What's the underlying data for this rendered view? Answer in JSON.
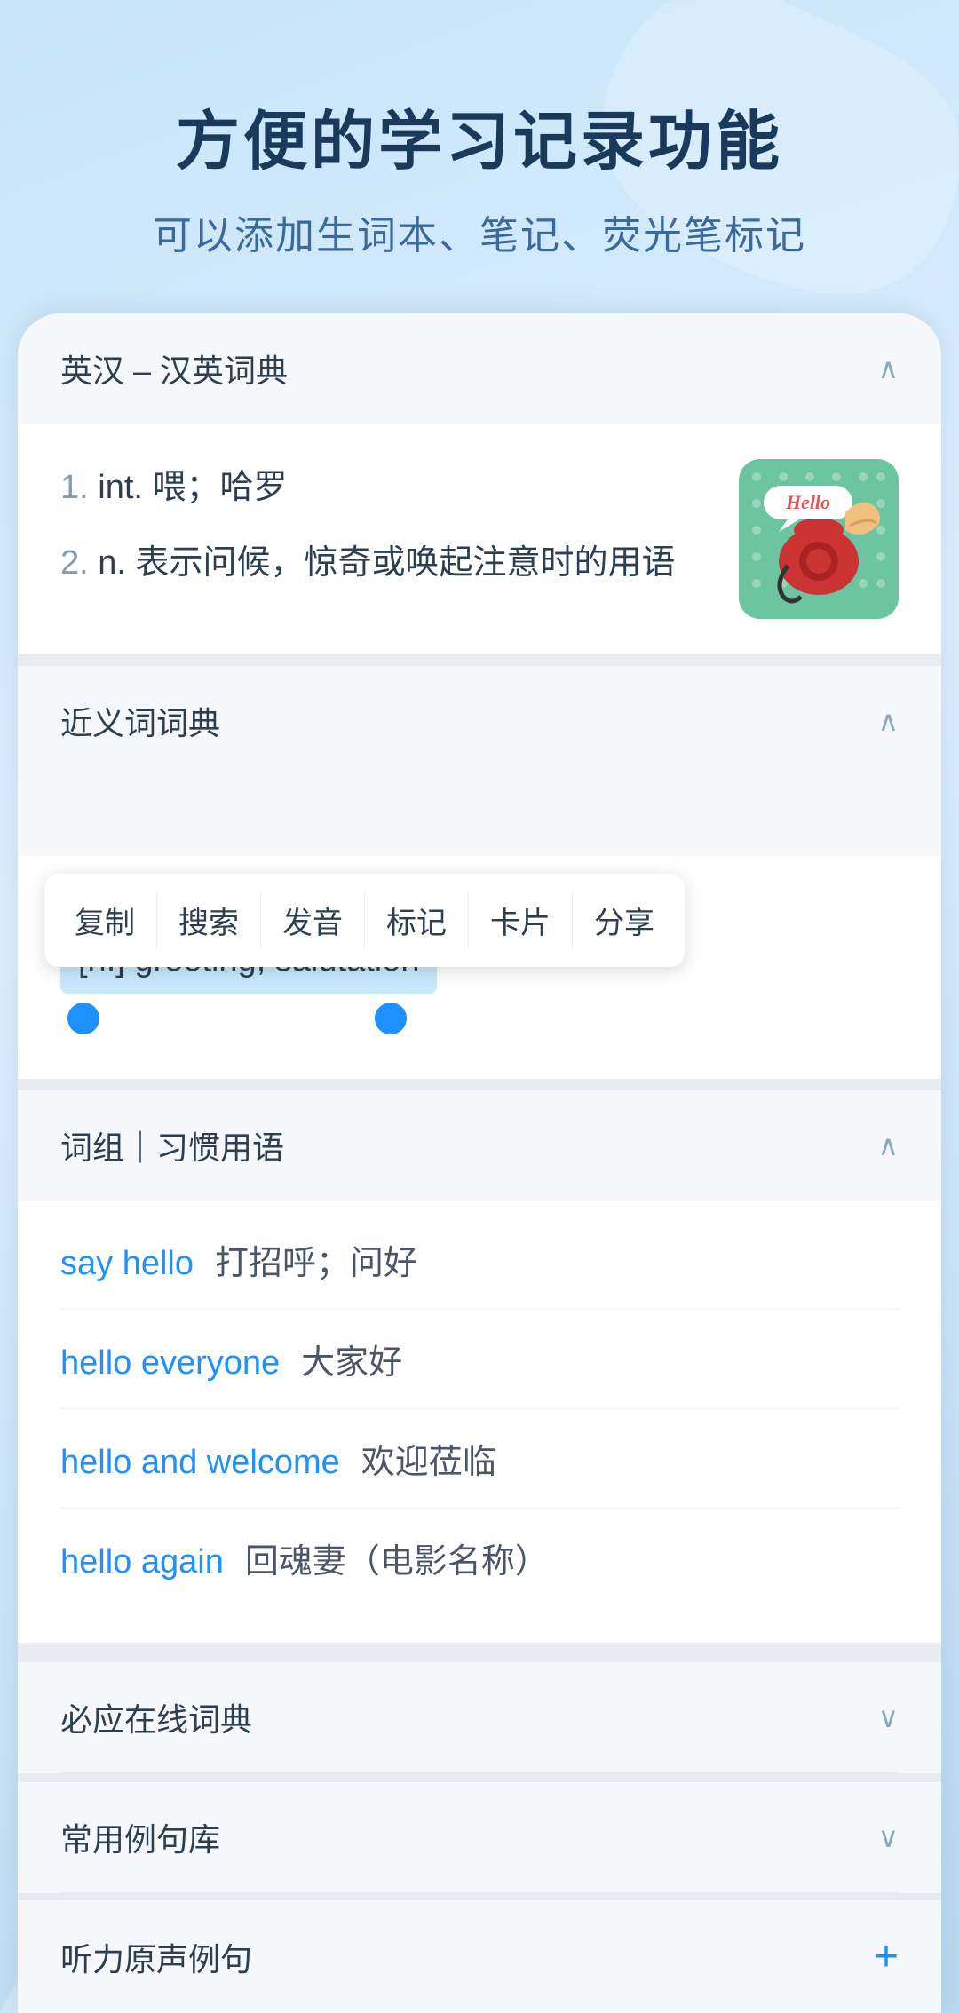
{
  "header": {
    "title": "方便的学习记录功能",
    "subtitle": "可以添加生词本、笔记、荧光笔标记"
  },
  "sections": {
    "dict": {
      "title": "英汉 – 汉英词典",
      "chevron": "expand"
    },
    "synonym": {
      "title": "近义词词典",
      "chevron": "expand"
    },
    "phrases": {
      "title": "词组｜习惯用语",
      "chevron": "expand"
    },
    "biying": {
      "title": "必应在线词典",
      "chevron": "collapse"
    },
    "examples": {
      "title": "常用例句库",
      "chevron": "collapse"
    },
    "listening": {
      "title": "听力原声例句",
      "has_plus": true
    }
  },
  "dict_entries": [
    {
      "num": "1.",
      "pos": "int.",
      "definition": "喂；哈罗"
    },
    {
      "num": "2.",
      "pos": "n.",
      "definition": "表示问候，惊奇或唤起注意时的用语"
    }
  ],
  "hello_image_alt": "Hello telephone illustration",
  "context_menu": {
    "items": [
      "复制",
      "搜索",
      "发音",
      "标记",
      "卡片",
      "分享"
    ]
  },
  "synonym_highlighted": "[n.] greeting, salutation",
  "phrases": [
    {
      "en": "say hello",
      "zh": "打招呼；问好"
    },
    {
      "en": "hello everyone",
      "zh": "大家好"
    },
    {
      "en": "hello and welcome",
      "zh": "欢迎莅临"
    },
    {
      "en": "hello again",
      "zh": "回魂妻（电影名称）"
    }
  ],
  "icons": {
    "chevron_up": "∧",
    "chevron_down": "∨",
    "plus": "+"
  },
  "colors": {
    "accent_blue": "#1e90ff",
    "dark_navy": "#1a3a5c",
    "text_primary": "#2c3e50",
    "bg_light": "#f5f7fa",
    "bg_gradient_start": "#c8e4f8",
    "bg_gradient_end": "#b8d8f0",
    "selection_bg": "#c8e8ff"
  }
}
